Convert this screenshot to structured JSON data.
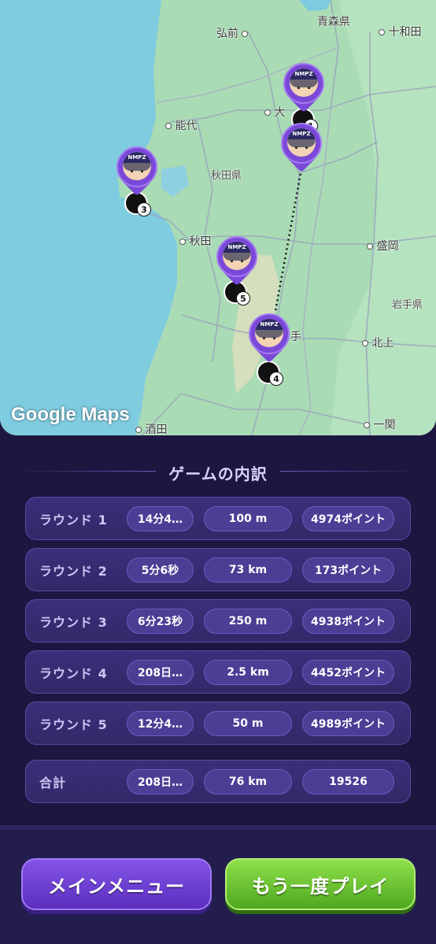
{
  "map": {
    "attribution": "Google Maps",
    "places": {
      "aomori": "青森県",
      "hirosaki": "弘前",
      "towada": "十和田",
      "odate": "大",
      "noshiro": "能代",
      "akita_pref": "秋田県",
      "akita": "秋田",
      "morioka": "盛岡",
      "iwate": "岩手県",
      "kitakami": "北上",
      "yokote": "手",
      "sakata": "酒田",
      "ichinoseki": "一関"
    },
    "pin_logo": "NMPZ",
    "guesses": [
      "1",
      "3",
      "5",
      "4"
    ]
  },
  "breakdown": {
    "title": "ゲームの内訳",
    "rounds": [
      {
        "label": "ラウンド 1",
        "time": "14分4…",
        "distance": "100 m",
        "score": "4974ポイント"
      },
      {
        "label": "ラウンド 2",
        "time": "5分6秒",
        "distance": "73 km",
        "score": "173ポイント"
      },
      {
        "label": "ラウンド 3",
        "time": "6分23秒",
        "distance": "250 m",
        "score": "4938ポイント"
      },
      {
        "label": "ラウンド 4",
        "time": "208日…",
        "distance": "2.5 km",
        "score": "4452ポイント"
      },
      {
        "label": "ラウンド 5",
        "time": "12分4…",
        "distance": "50 m",
        "score": "4989ポイント"
      }
    ],
    "total": {
      "label": "合計",
      "time": "208日…",
      "distance": "76 km",
      "score": "19526"
    }
  },
  "buttons": {
    "main_menu": "メインメニュー",
    "play_again": "もう一度プレイ"
  }
}
